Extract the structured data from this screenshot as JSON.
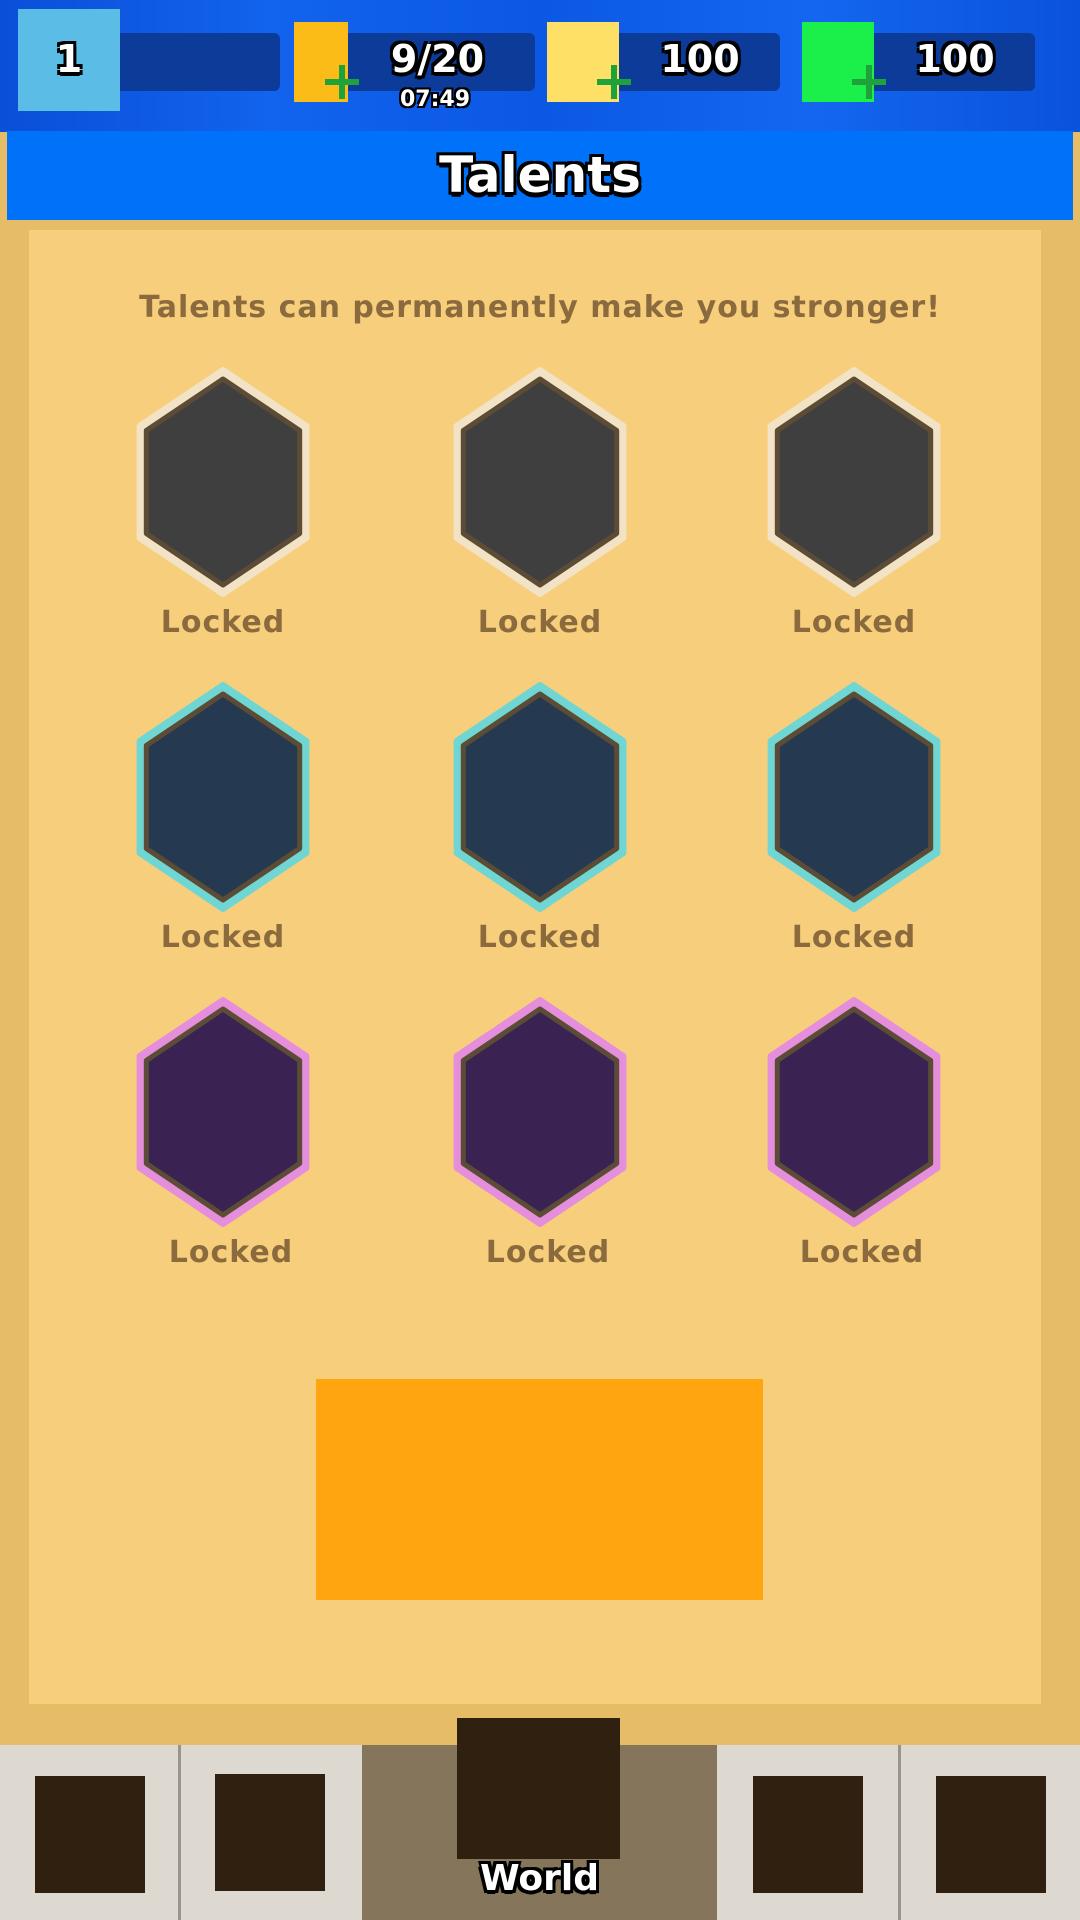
{
  "top_bar": {
    "level": {
      "value": "1",
      "icon": "level-badge-icon",
      "color": "#5bbde6"
    },
    "energy": {
      "value": "9/20",
      "timer": "07:49",
      "icon": "energy-icon",
      "color": "#fcbc18"
    },
    "gold": {
      "value": "100",
      "icon": "gold-icon",
      "color": "#fde065"
    },
    "gems": {
      "value": "100",
      "icon": "gem-icon",
      "color": "#1aef4a"
    }
  },
  "header": {
    "title": "Talents"
  },
  "panel": {
    "subtitle": "Talents can permanently make you stronger!",
    "talents": [
      {
        "label": "Locked",
        "tier": "common",
        "fill": "#3f3f3f",
        "rim": "#f3e3c6"
      },
      {
        "label": "Locked",
        "tier": "common",
        "fill": "#3f3f3f",
        "rim": "#f3e3c6"
      },
      {
        "label": "Locked",
        "tier": "common",
        "fill": "#3f3f3f",
        "rim": "#f3e3c6"
      },
      {
        "label": "Locked",
        "tier": "rare",
        "fill": "#253a50",
        "rim": "#6fd6d3"
      },
      {
        "label": "Locked",
        "tier": "rare",
        "fill": "#253a50",
        "rim": "#6fd6d3"
      },
      {
        "label": "Locked",
        "tier": "rare",
        "fill": "#253a50",
        "rim": "#6fd6d3"
      },
      {
        "label": "Locked",
        "tier": "epic",
        "fill": "#3a2352",
        "rim": "#e58fdc"
      },
      {
        "label": "Locked",
        "tier": "epic",
        "fill": "#3a2352",
        "rim": "#e58fdc"
      },
      {
        "label": "Locked",
        "tier": "epic",
        "fill": "#3a2352",
        "rim": "#e58fdc"
      }
    ],
    "action_button_color": "#ffa50f"
  },
  "bottom_nav": {
    "active_label": "World",
    "items": [
      "shop-icon",
      "inventory-icon",
      "world-icon",
      "quests-icon",
      "settings-icon"
    ]
  }
}
